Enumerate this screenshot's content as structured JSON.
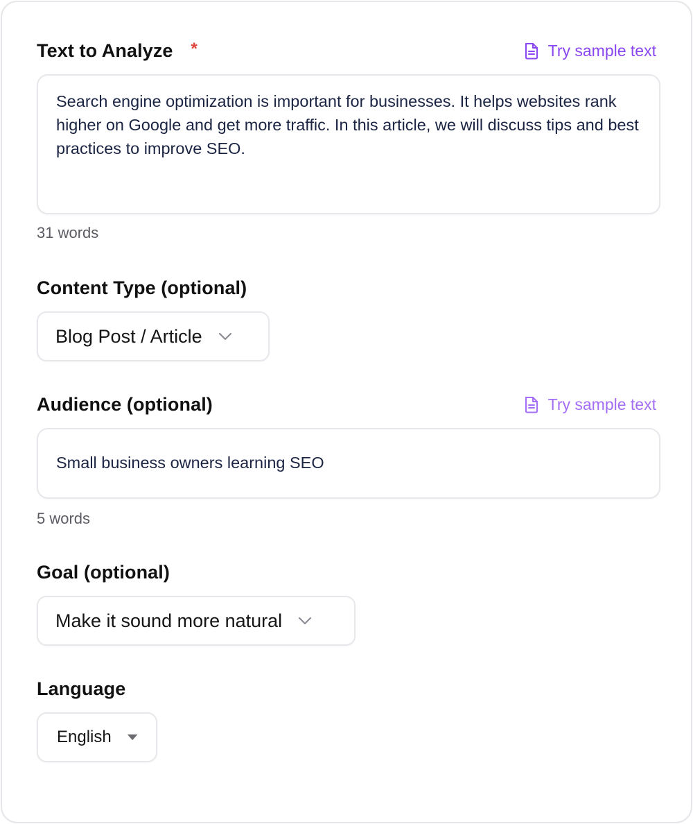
{
  "text_section": {
    "label": "Text to Analyze",
    "required_mark": "*",
    "sample_link": "Try sample text",
    "value": "Search engine optimization is important for businesses. It helps websites rank higher on Google and get more traffic. In this article, we will discuss tips and best practices to improve SEO.",
    "word_count": "31 words"
  },
  "content_type": {
    "label": "Content Type (optional)",
    "selected": "Blog Post / Article"
  },
  "audience": {
    "label": "Audience (optional)",
    "sample_link": "Try sample text",
    "value": "Small business owners learning SEO",
    "word_count": "5 words"
  },
  "goal": {
    "label": "Goal (optional)",
    "selected": "Make it sound more natural"
  },
  "language": {
    "label": "Language",
    "selected": "English"
  },
  "colors": {
    "accent": "#8a46f0",
    "required": "#e0453b",
    "text_dark": "#1b2442",
    "border": "#e7e7ec"
  },
  "icons": {
    "sample_link_icon": "document-icon",
    "dropdown_icon": "chevron-down-icon",
    "language_dropdown_icon": "caret-down-icon"
  }
}
